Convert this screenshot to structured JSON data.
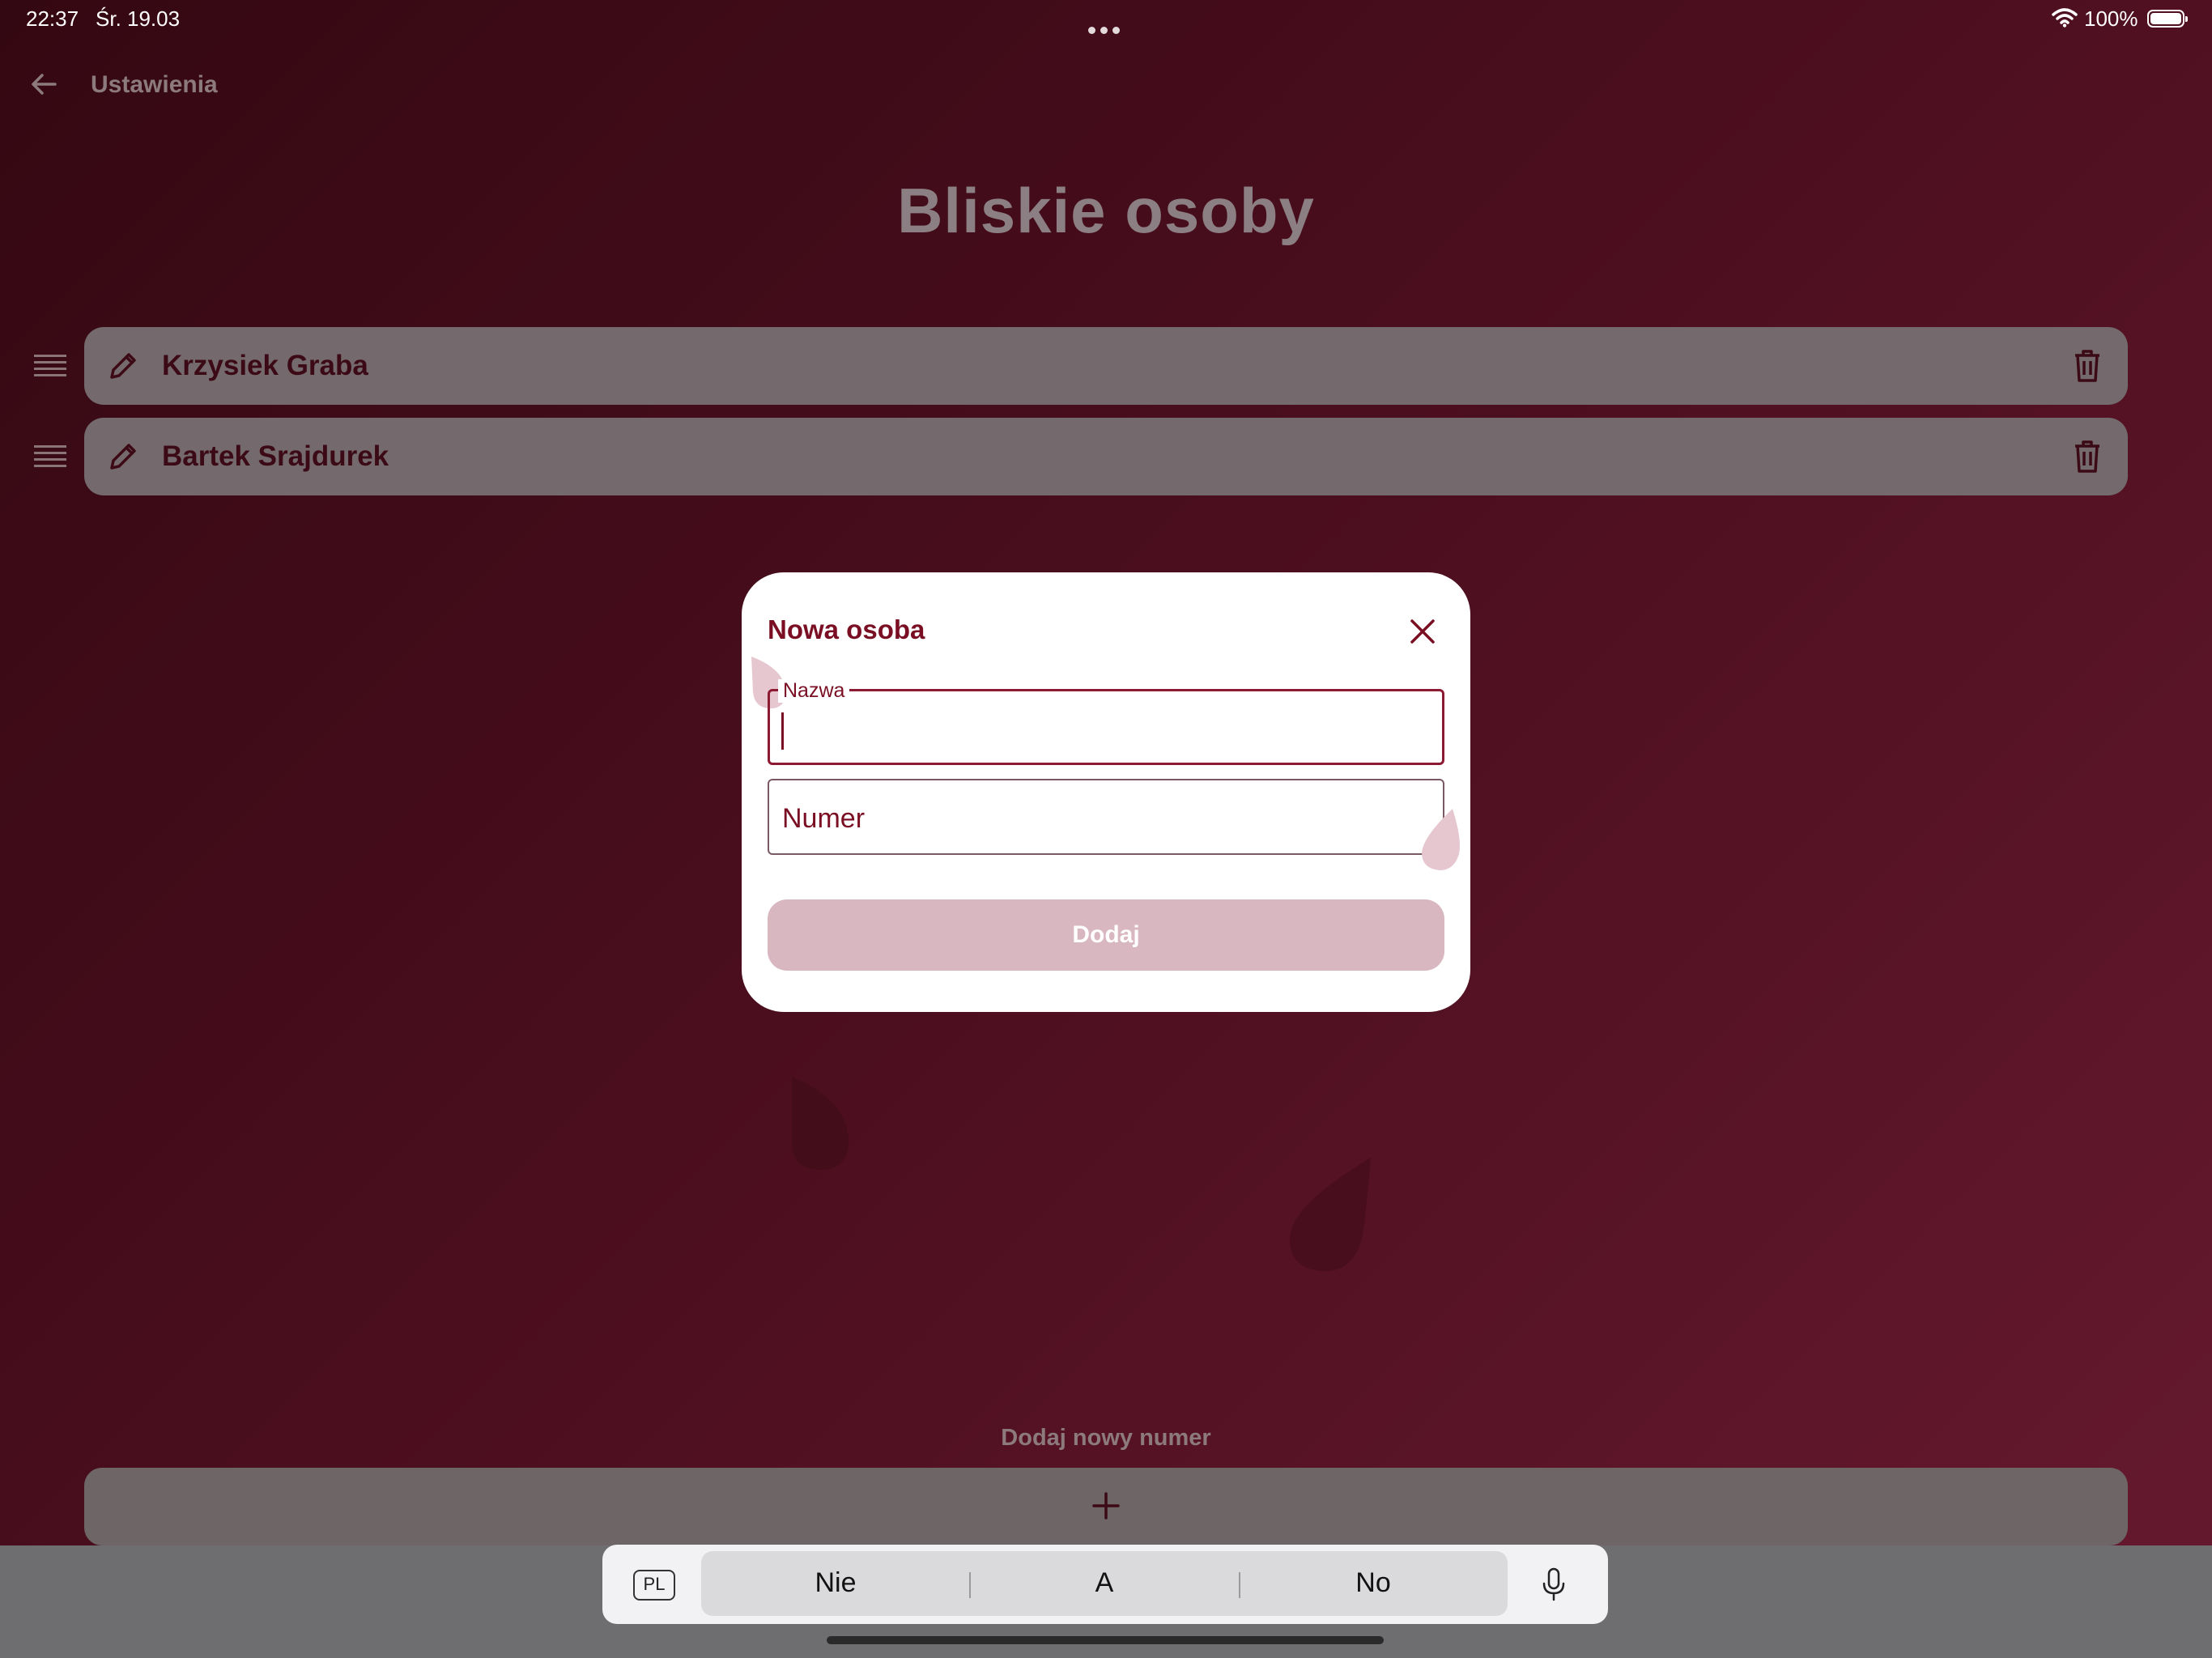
{
  "status": {
    "time": "22:37",
    "date": "Śr. 19.03",
    "battery": "100%"
  },
  "nav": {
    "back_label": "Ustawienia"
  },
  "page": {
    "title": "Bliskie osoby"
  },
  "contacts": [
    {
      "name": "Krzysiek Graba"
    },
    {
      "name": "Bartek Srajdurek"
    }
  ],
  "add_section": {
    "label": "Dodaj nowy numer"
  },
  "modal": {
    "title": "Nowa osoba",
    "name_field_label": "Nazwa",
    "number_field_placeholder": "Numer",
    "submit_label": "Dodaj"
  },
  "keyboard": {
    "language": "PL",
    "suggestions": [
      "Nie",
      "A",
      "No"
    ]
  },
  "colors": {
    "accent": "#7a0f24",
    "background_start": "#340812",
    "background_end": "#66192f",
    "card": "#746a6d",
    "disabled_button": "#d8b7c0"
  }
}
